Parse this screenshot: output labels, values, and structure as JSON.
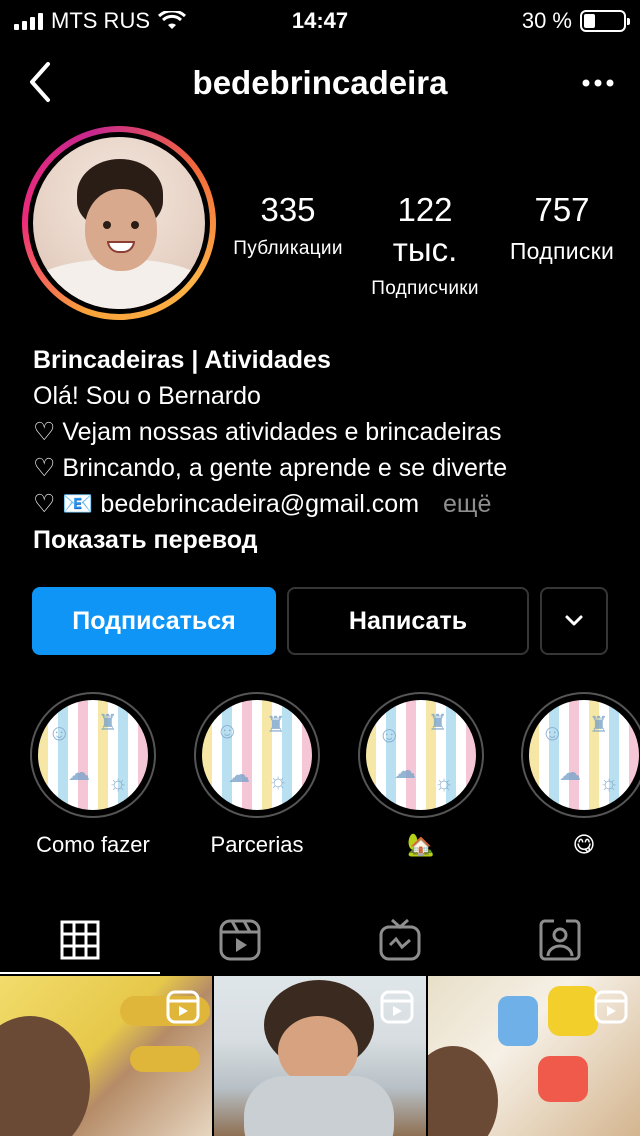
{
  "status_bar": {
    "carrier": "MTS RUS",
    "time": "14:47",
    "battery_text": "30 %",
    "battery_level": 0.3
  },
  "header": {
    "username": "bedebrincadeira",
    "icons": [
      "chevron-left-icon",
      "more-dots-icon"
    ]
  },
  "stats": [
    {
      "value": "335",
      "label": "Публикации"
    },
    {
      "value": "122 тыс.",
      "label": "Подписчики"
    },
    {
      "value": "757",
      "label": "Подписки"
    }
  ],
  "bio": {
    "name": "Brincadeiras | Atividades",
    "lines": [
      "Olá! Sou o Bernardo",
      "♡ Vejam nossas atividades e brincadeiras",
      "♡ Brincando, a gente aprende e se diverte",
      "♡ 📧 bedebrincadeira@gmail.com"
    ],
    "more": "ещё",
    "translate": "Показать перевод"
  },
  "actions": {
    "follow": "Подписаться",
    "message": "Написать"
  },
  "highlights": [
    {
      "caption": "Como fazer"
    },
    {
      "caption": "Parcerias"
    },
    {
      "caption": "🏡"
    },
    {
      "caption": "😋"
    }
  ],
  "tabs": [
    "grid-icon",
    "reels-icon",
    "igtv-icon",
    "tagged-icon"
  ],
  "colors": {
    "accent_blue": "#0f95f6",
    "background": "#000000",
    "muted": "#8e8e8e"
  }
}
